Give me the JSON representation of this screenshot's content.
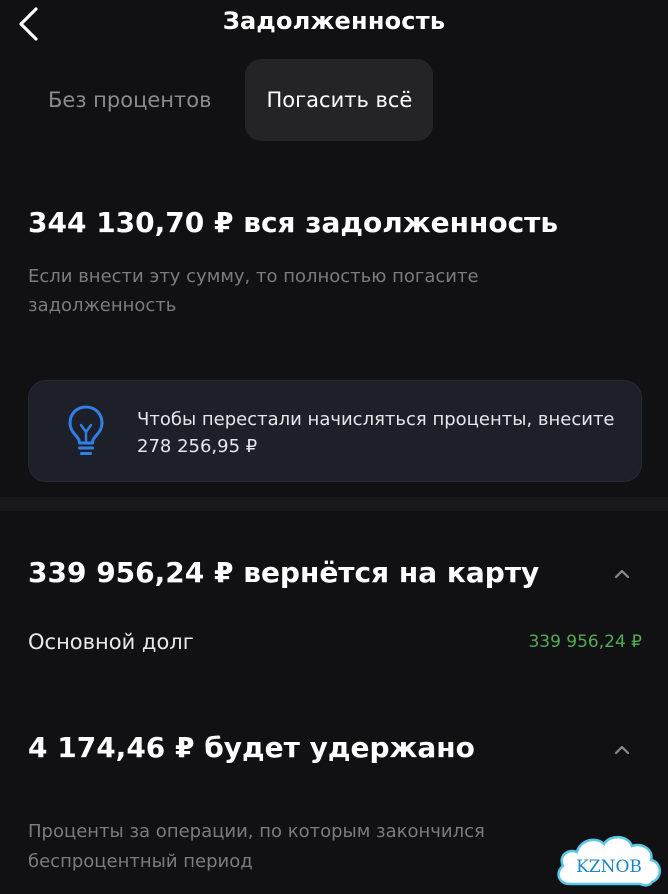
{
  "header": {
    "title": "Задолженность"
  },
  "tabs": [
    {
      "label": "Без процентов",
      "active": false
    },
    {
      "label": "Погасить всё",
      "active": true
    }
  ],
  "summary": {
    "total_line": "344 130,70 ₽ вся задолженность",
    "note": "Если внести эту сумму, то полностью погасите задолженность"
  },
  "info_card": {
    "text": "Чтобы перестали начисляться проценты, внесите 278 256,95 ₽"
  },
  "refund_section": {
    "headline": "339 956,24 ₽ вернётся на карту",
    "row_label": "Основной долг",
    "row_value": "339 956,24 ₽"
  },
  "withheld_section": {
    "headline": "4 174,46 ₽ будет удержано",
    "note": "Проценты за операции, по которым закончился беспроцентный период"
  },
  "watermark": {
    "text": "KZNOB"
  },
  "colors": {
    "background": "#111113",
    "accent_blue": "#2f7fe6",
    "positive_green": "#4fae54",
    "muted_text": "#7b7b80"
  }
}
